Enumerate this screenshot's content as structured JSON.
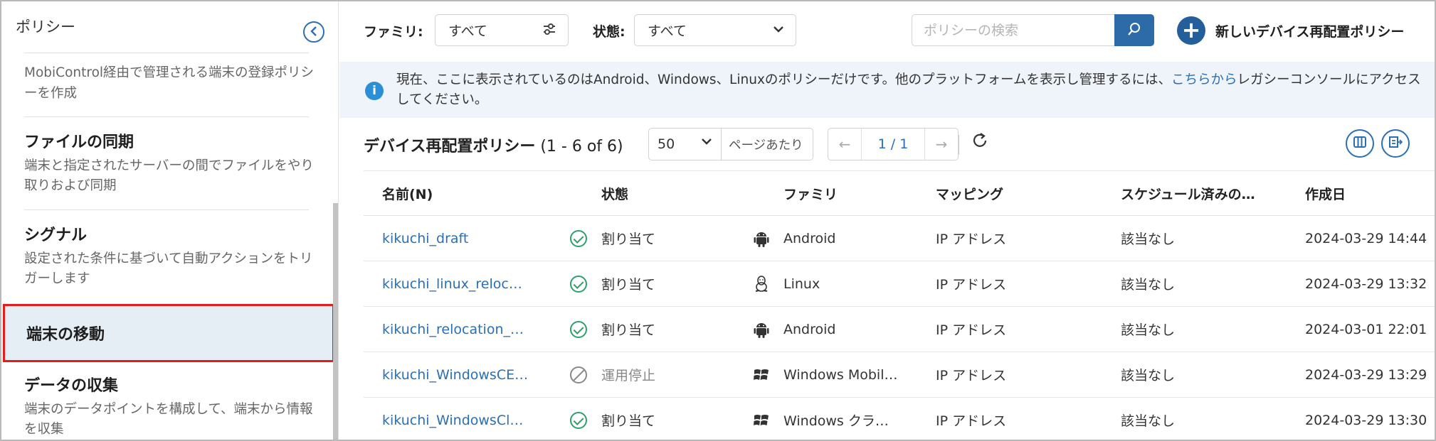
{
  "sidebar": {
    "title": "ポリシー",
    "desc0": "MobiControl経由で管理される端末の登録ポリシーを作成",
    "items": [
      {
        "title": "ファイルの同期",
        "desc": "端末と指定されたサーバーの間でファイルをやり取りおよび同期"
      },
      {
        "title": "シグナル",
        "desc": "設定された条件に基づいて自動アクションをトリガーします"
      },
      {
        "title": "端末の移動",
        "desc": ""
      },
      {
        "title": "データの収集",
        "desc": "端末のデータポイントを構成して、端末から情報を収集"
      }
    ]
  },
  "toolbar": {
    "family_label": "ファミリ:",
    "family_value": "すべて",
    "state_label": "状態:",
    "state_value": "すべて",
    "search_placeholder": "ポリシーの検索",
    "new_button_label": "新しいデバイス再配置ポリシー"
  },
  "banner": {
    "text_before": "現在、ここに表示されているのはAndroid、Windows、Linuxのポリシーだけです。他のプラットフォームを表示し管理するには、",
    "link": "こちらから",
    "text_after": "レガシーコンソールにアクセスしてください。"
  },
  "list": {
    "title": "デバイス再配置ポリシー",
    "range": "(1 - 6 of 6)",
    "per_page_value": "50",
    "per_page_unit": "ページあたり",
    "page": "1 / 1"
  },
  "table": {
    "headers": {
      "name": "名前(N)",
      "state": "状態",
      "family": "ファミリ",
      "mapping": "マッピング",
      "scheduled": "スケジュール済みの…",
      "created": "作成日"
    },
    "rows": [
      {
        "name": "kikuchi_draft",
        "state": "割り当て",
        "state_icon": "check-circle-icon",
        "family_icon": "android-icon",
        "family": "Android",
        "mapping": "IP アドレス",
        "scheduled": "該当なし",
        "created": "2024-03-29 14:44"
      },
      {
        "name": "kikuchi_linux_reloc…",
        "state": "割り当て",
        "state_icon": "check-circle-icon",
        "family_icon": "linux-icon",
        "family": "Linux",
        "mapping": "IP アドレス",
        "scheduled": "該当なし",
        "created": "2024-03-29 13:32"
      },
      {
        "name": "kikuchi_relocation_…",
        "state": "割り当て",
        "state_icon": "check-circle-icon",
        "family_icon": "android-icon",
        "family": "Android",
        "mapping": "IP アドレス",
        "scheduled": "該当なし",
        "created": "2024-03-01 22:01"
      },
      {
        "name": "kikuchi_WindowsCE…",
        "state": "運用停止",
        "state_icon": "disabled-circle-icon",
        "family_icon": "windows-icon",
        "family": "Windows Mobil…",
        "mapping": "IP アドレス",
        "scheduled": "該当なし",
        "created": "2024-03-29 13:29"
      },
      {
        "name": "kikuchi_WindowsCl…",
        "state": "割り当て",
        "state_icon": "check-circle-icon",
        "family_icon": "windows-icon",
        "family": "Windows クラ…",
        "mapping": "IP アドレス",
        "scheduled": "該当なし",
        "created": "2024-03-29 13:30"
      }
    ]
  },
  "colors": {
    "accent": "#2a6fb5",
    "highlight_border": "#e51c1c",
    "active_bg": "#e6eef5",
    "success": "#2aa06a"
  }
}
